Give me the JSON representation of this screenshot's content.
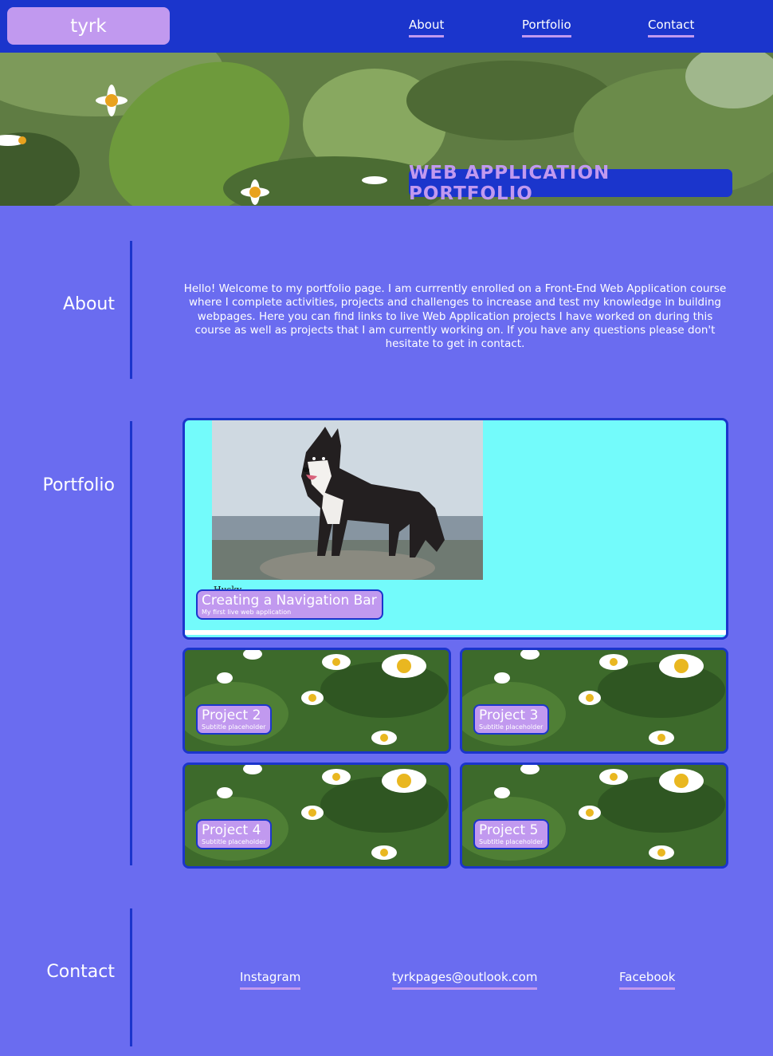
{
  "header": {
    "logo": "tyrk",
    "nav": [
      "About",
      "Portfolio",
      "Contact"
    ]
  },
  "hero": {
    "title": "WEB APPLICATION PORTFOLIO"
  },
  "about": {
    "heading": "About",
    "text": "Hello! Welcome to my portfolio page. I am currrently enrolled on a Front-End Web Application course where I complete activities, projects and challenges to increase and test my knowledge in building webpages. Here you can find links to live Web Application projects I have worked on during this course as well as projects that I am currently working on. If you have any questions please don't hesitate to get in contact."
  },
  "portfolio": {
    "heading": "Portfolio",
    "featured": {
      "image_caption": "Husky",
      "title": "Creating a Navigation Bar",
      "subtitle": "My first live web application"
    },
    "projects": [
      {
        "title": "Project 2",
        "subtitle": "Subtitle placeholder"
      },
      {
        "title": "Project 3",
        "subtitle": "Subtitle placeholder"
      },
      {
        "title": "Project 4",
        "subtitle": "Subtitle placeholder"
      },
      {
        "title": "Project 5",
        "subtitle": "Subtitle placeholder"
      }
    ]
  },
  "contact": {
    "heading": "Contact",
    "links": [
      "Instagram",
      "tyrkpages@outlook.com",
      "Facebook"
    ]
  },
  "colors": {
    "background": "#6a6cf0",
    "header": "#1b35cc",
    "accent": "#c199ef",
    "featured_bg": "#73fbfb"
  }
}
